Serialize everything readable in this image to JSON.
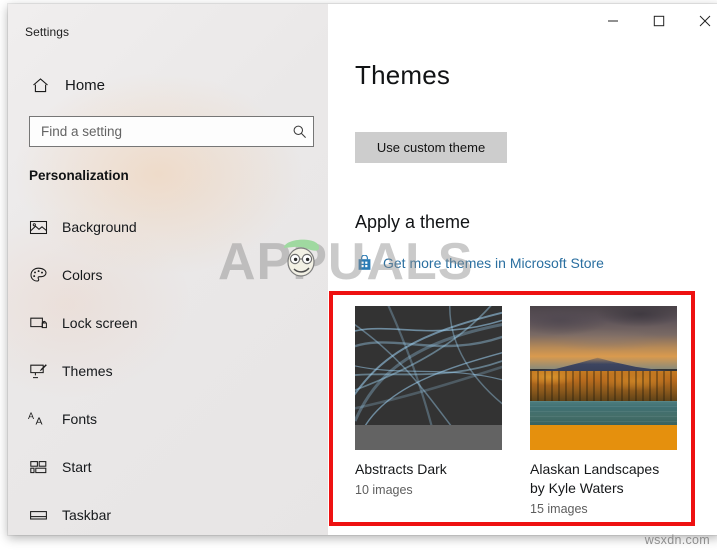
{
  "window": {
    "title": "Settings",
    "controls": [
      {
        "name": "minimize",
        "glyph": "minimize-icon"
      },
      {
        "name": "maximize",
        "glyph": "maximize-icon"
      },
      {
        "name": "close",
        "glyph": "close-icon"
      }
    ]
  },
  "sidebar": {
    "home_label": "Home",
    "home_icon": "home-icon",
    "search": {
      "placeholder": "Find a setting",
      "value": "",
      "icon": "search-icon"
    },
    "section_heading": "Personalization",
    "items": [
      {
        "label": "Background",
        "icon": "picture-icon"
      },
      {
        "label": "Colors",
        "icon": "palette-icon"
      },
      {
        "label": "Lock screen",
        "icon": "lock-screen-icon"
      },
      {
        "label": "Themes",
        "icon": "brush-icon"
      },
      {
        "label": "Fonts",
        "icon": "fonts-aa-icon"
      },
      {
        "label": "Start",
        "icon": "start-tiles-icon"
      },
      {
        "label": "Taskbar",
        "icon": "taskbar-icon"
      }
    ]
  },
  "main": {
    "page_title": "Themes",
    "custom_theme_button": "Use custom theme",
    "apply_heading": "Apply a theme",
    "store_link": {
      "text": "Get more themes in Microsoft Store",
      "icon": "microsoft-store-icon",
      "color": "#2a6fa0"
    },
    "themes": [
      {
        "name": "Abstracts Dark",
        "image_count": "10 images",
        "accent_color": "#636363",
        "thumbnail": "abstract-blue-light-curves"
      },
      {
        "name": "Alaskan Landscapes by Kyle Waters",
        "image_count": "15 images",
        "accent_color": "#e5900d",
        "thumbnail": "autumn-mountain-river-landscape"
      }
    ]
  },
  "annotations": {
    "highlight_color": "#ee1111"
  },
  "watermarks": {
    "brand": "APPUALS",
    "site": "wsxdn.com"
  }
}
